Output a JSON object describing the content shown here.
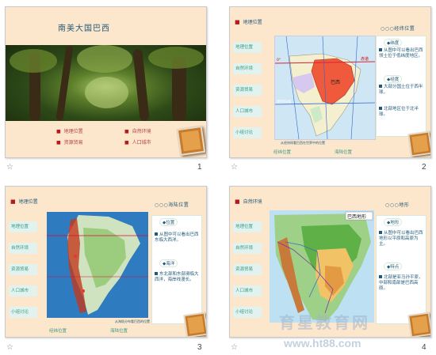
{
  "colors": {
    "slide_bg": "#fde7cc",
    "accent_text": "#205a7a",
    "teal": "#3a9a86",
    "red_dot": "#b31b1b"
  },
  "slide1": {
    "title": "南美大国巴西",
    "nav": [
      "地理位置",
      "自然环境",
      "资源贸易",
      "人口城市"
    ],
    "number": "1"
  },
  "slide2": {
    "header": "地理位置",
    "header_right": "○○○经纬位置",
    "side": [
      "地理位置",
      "自然环境",
      "资源贸易",
      "人口城市",
      "小组讨论"
    ],
    "pill1": "纬度",
    "text1": "从图中可以看出巴西领土位于低纬度地区。",
    "pill2": "经度",
    "text2a": "大部分国土位于西半球，",
    "text2b": "北部地区位于北半球。",
    "map_labels": {
      "equator": "赤道",
      "capricorn": "南回归线",
      "brazil": "巴西",
      "lat": "0°"
    },
    "bottom_left": "经纬位置",
    "bottom_right": "海陆位置",
    "caption": "从经纬网看巴西在世界中的位置",
    "number": "2"
  },
  "slide3": {
    "header": "地理位置",
    "header_right": "○○○海陆位置",
    "side": [
      "地理位置",
      "自然环境",
      "资源贸易",
      "人口城市",
      "小组讨论"
    ],
    "pill1": "位置",
    "text1": "从图中可以看出巴西东临大西洋。",
    "pill2": "海洋",
    "text2": "东北部和东部濒临大西洋，海岸线漫长。",
    "bottom_left": "经纬位置",
    "bottom_right": "海陆位置",
    "caption": "从海陆分布看巴西的位置",
    "number": "3"
  },
  "slide4": {
    "header": "自然环境",
    "header_right": "○○○地形",
    "side": [
      "地理位置",
      "自然环境",
      "资源贸易",
      "人口城市",
      "小组讨论"
    ],
    "map_title": "巴西地形",
    "pill1": "地形",
    "text1": "从图中可以看出巴西地形以平原和高原为主。",
    "pill2": "特点",
    "text2": "北部是亚马孙平原，中部和南部是巴西高原。",
    "number": "4"
  },
  "watermark": {
    "logo": "育星教育网",
    "url": "www.ht88.com"
  }
}
